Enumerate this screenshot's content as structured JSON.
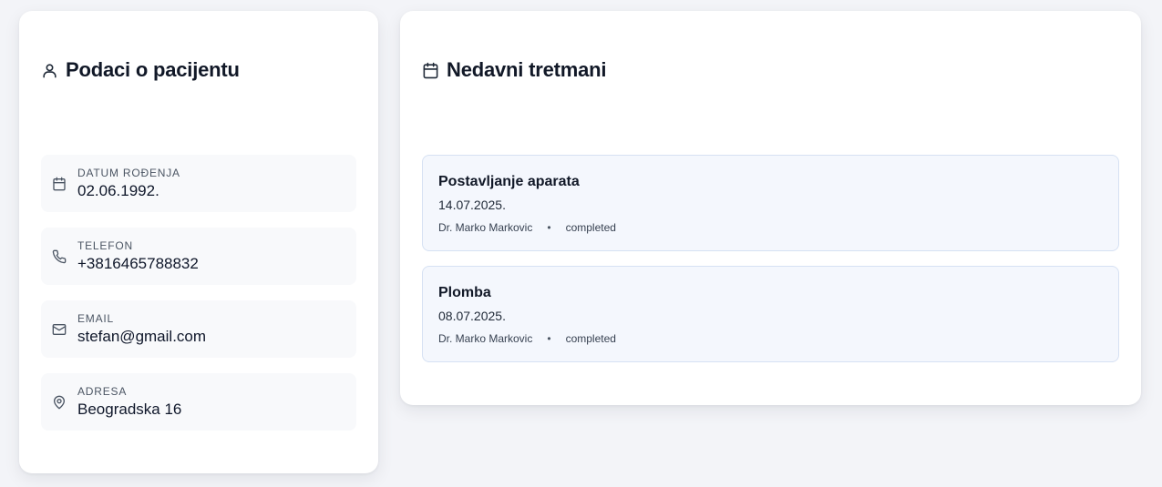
{
  "patient": {
    "title": "Podaci o pacijentu",
    "title_icon": "user-icon",
    "fields": [
      {
        "label": "DATUM ROĐENJA",
        "value": "02.06.1992.",
        "icon": "calendar-icon"
      },
      {
        "label": "TELEFON",
        "value": "+3816465788832",
        "icon": "phone-icon"
      },
      {
        "label": "EMAIL",
        "value": "stefan@gmail.com",
        "icon": "mail-icon"
      },
      {
        "label": "ADRESA",
        "value": "Beogradska 16",
        "icon": "map-pin-icon"
      }
    ]
  },
  "treatments": {
    "title": "Nedavni tretmani",
    "title_icon": "calendar-icon",
    "items": [
      {
        "name": "Postavljanje aparata",
        "date": "14.07.2025.",
        "doctor": "Dr. Marko Markovic",
        "separator": "•",
        "status": "completed"
      },
      {
        "name": "Plomba",
        "date": "08.07.2025.",
        "doctor": "Dr. Marko Markovic",
        "separator": "•",
        "status": "completed"
      }
    ]
  },
  "colors": {
    "page_bg": "#f3f4f8",
    "card_bg": "#ffffff",
    "info_item_bg": "#f8f9fb",
    "treatment_bg": "#f4f7fd",
    "treatment_border": "#d6e1f3"
  }
}
